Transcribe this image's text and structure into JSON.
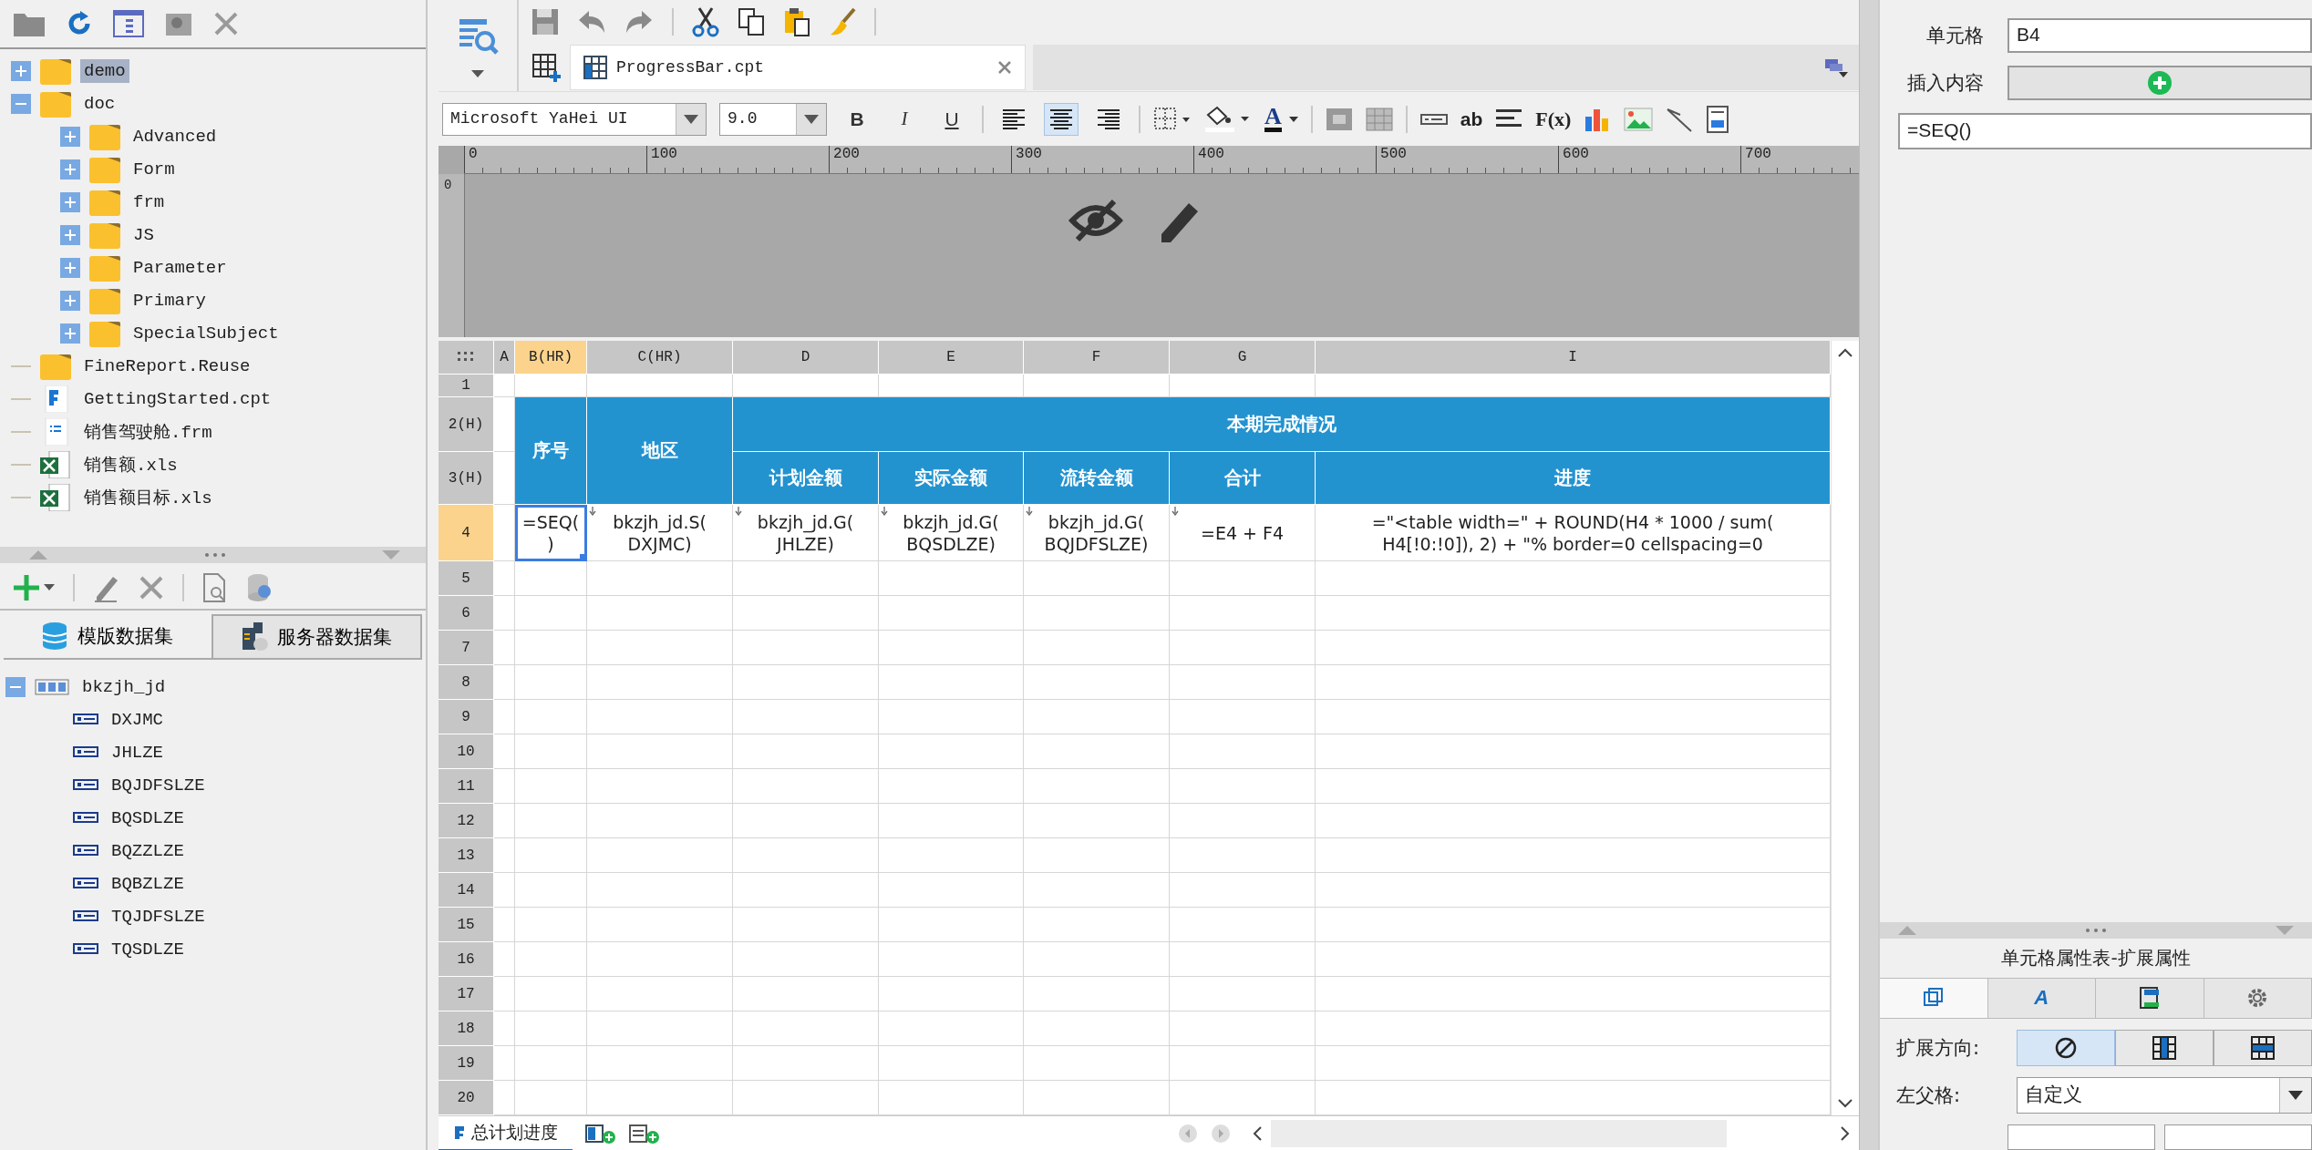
{
  "explorer_tree": [
    {
      "label": "demo",
      "kind": "folder",
      "expanded": false,
      "selected": true
    },
    {
      "label": "doc",
      "kind": "folder",
      "expanded": true,
      "selected": false,
      "children": [
        {
          "label": "Advanced",
          "kind": "folder",
          "expanded": false,
          "selected": false
        },
        {
          "label": "Form",
          "kind": "folder",
          "expanded": false,
          "selected": false
        },
        {
          "label": "frm",
          "kind": "folder",
          "expanded": false,
          "selected": false
        },
        {
          "label": "JS",
          "kind": "folder",
          "expanded": false,
          "selected": false
        },
        {
          "label": "Parameter",
          "kind": "folder",
          "expanded": false,
          "selected": false
        },
        {
          "label": "Primary",
          "kind": "folder",
          "expanded": false,
          "selected": false
        },
        {
          "label": "SpecialSubject",
          "kind": "folder",
          "expanded": false,
          "selected": false
        }
      ]
    },
    {
      "label": "FineReport.Reuse",
      "kind": "plain_folder",
      "selected": false
    },
    {
      "label": "GettingStarted.cpt",
      "kind": "cpt",
      "selected": false
    },
    {
      "label": "销售驾驶舱.frm",
      "kind": "frm",
      "selected": false
    },
    {
      "label": "销售额.xls",
      "kind": "xls",
      "selected": false
    },
    {
      "label": "销售额目标.xls",
      "kind": "xls",
      "selected": false
    }
  ],
  "dataset_tabs": [
    {
      "label": "模版数据集",
      "kind": "template",
      "selected": true
    },
    {
      "label": "服务器数据集",
      "kind": "server",
      "selected": false
    }
  ],
  "datasets": [
    {
      "name": "bkzjh_jd",
      "expanded": true,
      "fields": [
        "DXJMC",
        "JHLZE",
        "BQJDFSLZE",
        "BQSDLZE",
        "BQZZLZE",
        "BQBZLZE",
        "TQJDFSLZE",
        "TQSDLZE"
      ]
    }
  ],
  "editor_tab": {
    "label": "ProgressBar.cpt"
  },
  "format_toolbar": {
    "font": "Microsoft YaHei UI",
    "size": "9.0",
    "style_buttons": [
      {
        "label": "B",
        "kind": "bold"
      },
      {
        "label": "I",
        "kind": "italic"
      },
      {
        "label": "U",
        "kind": "underline"
      }
    ],
    "alignments": [
      {
        "kind": "left",
        "selected": false
      },
      {
        "kind": "center",
        "selected": true
      },
      {
        "kind": "right",
        "selected": false
      }
    ],
    "font_color_glyph": "A",
    "text_glyph": "ab",
    "formula_glyph": "F(x)"
  },
  "ruler": {
    "top_labels": [
      "0",
      "100",
      "200",
      "300",
      "400",
      "500",
      "600",
      "700"
    ],
    "side_label": "0"
  },
  "grid": {
    "columns": [
      {
        "label": "A",
        "selected": false
      },
      {
        "label": "B(HR)",
        "selected": true
      },
      {
        "label": "C(HR)",
        "selected": false
      },
      {
        "label": "D",
        "selected": false
      },
      {
        "label": "E",
        "selected": false
      },
      {
        "label": "F",
        "selected": false
      },
      {
        "label": "G",
        "selected": false
      },
      {
        "label": "I",
        "selected": false
      }
    ],
    "rows": [
      {
        "label": "1",
        "selected": false
      },
      {
        "label": "2(H)",
        "selected": false
      },
      {
        "label": "3(H)",
        "selected": false
      },
      {
        "label": "4",
        "selected": true
      },
      {
        "label": "5",
        "selected": false
      },
      {
        "label": "6",
        "selected": false
      },
      {
        "label": "7",
        "selected": false
      },
      {
        "label": "8",
        "selected": false
      },
      {
        "label": "9",
        "selected": false
      },
      {
        "label": "10",
        "selected": false
      },
      {
        "label": "11",
        "selected": false
      },
      {
        "label": "12",
        "selected": false
      },
      {
        "label": "13",
        "selected": false
      },
      {
        "label": "14",
        "selected": false
      },
      {
        "label": "15",
        "selected": false
      },
      {
        "label": "16",
        "selected": false
      },
      {
        "label": "17",
        "selected": false
      },
      {
        "label": "18",
        "selected": false
      },
      {
        "label": "19",
        "selected": false
      },
      {
        "label": "20",
        "selected": false
      }
    ],
    "report_header": {
      "seq": "序号",
      "region": "地区",
      "group": "本期完成情况",
      "subheads": [
        "计划金额",
        "实际金额",
        "流转金额",
        "合计",
        "进度"
      ]
    },
    "data_row": [
      {
        "lines": [
          "=SEQ(",
          ")"
        ],
        "expand_marker": false,
        "selected": true
      },
      {
        "lines": [
          "bkzjh_jd.S(",
          "DXJMC)"
        ],
        "expand_marker": true,
        "selected": false
      },
      {
        "lines": [
          "bkzjh_jd.G(",
          "JHLZE)"
        ],
        "expand_marker": true,
        "selected": false
      },
      {
        "lines": [
          "bkzjh_jd.G(",
          "BQSDLZE)"
        ],
        "expand_marker": true,
        "selected": false
      },
      {
        "lines": [
          "bkzjh_jd.G(",
          "BQJDFSLZE)"
        ],
        "expand_marker": true,
        "selected": false
      },
      {
        "lines": [
          "=E4 + F4"
        ],
        "expand_marker": true,
        "selected": false
      },
      {
        "lines": [
          "=\"<table width=\" + ROUND(H4 * 1000 / sum(",
          "H4[!0:!0]), 2) + \"% border=0 cellspacing=0"
        ],
        "expand_marker": false,
        "selected": false
      }
    ]
  },
  "sheet_tabs": [
    {
      "label": "总计划进度",
      "selected": true
    }
  ],
  "cell_panel": {
    "cell_label": "单元格",
    "cell_value": "B4",
    "insert_label": "插入内容",
    "formula": "=SEQ()"
  },
  "property_panel": {
    "title": "单元格属性表-扩展属性",
    "tabs": [
      {
        "kind": "cell",
        "selected": true
      },
      {
        "kind": "style",
        "glyph": "A",
        "selected": false
      },
      {
        "kind": "widget",
        "selected": false
      },
      {
        "kind": "settings",
        "selected": false
      }
    ],
    "direction_label": "扩展方向:",
    "directions": [
      {
        "kind": "none",
        "selected": true
      },
      {
        "kind": "vertical",
        "selected": false
      },
      {
        "kind": "horizontal",
        "selected": false
      }
    ],
    "parent_label": "左父格:",
    "parent_value": "自定义"
  }
}
